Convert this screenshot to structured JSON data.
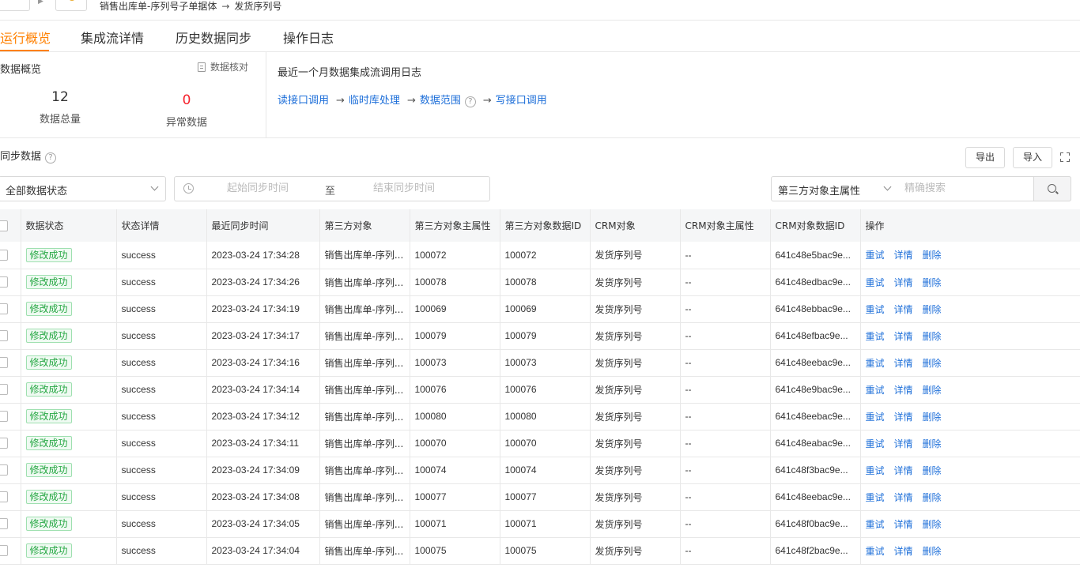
{
  "breadcrumb": {
    "source": "销售出库单-序列号子单据体",
    "target": "发货序列号"
  },
  "tabs": [
    "运行概览",
    "集成流详情",
    "历史数据同步",
    "操作日志"
  ],
  "overview": {
    "title": "数据概览",
    "check_label": "数据核对",
    "total_value": "12",
    "total_label": "数据总量",
    "error_value": "0",
    "error_label": "异常数据",
    "log_title": "最近一个月数据集成流调用日志",
    "flow": [
      "读接口调用",
      "临时库处理",
      "数据范围",
      "写接口调用"
    ],
    "status_colors": {
      "error": "#f5222d",
      "accent": "#ff8000",
      "link": "#1e6fd9",
      "success": "#27a844"
    }
  },
  "sync": {
    "title": "同步数据",
    "export_label": "导出",
    "import_label": "导入",
    "status_select": "全部数据状态",
    "start_placeholder": "起始同步时间",
    "to_label": "至",
    "end_placeholder": "结束同步时间",
    "field_select": "第三方对象主属性",
    "search_placeholder": "精确搜索"
  },
  "table": {
    "headers": [
      "数据状态",
      "状态详情",
      "最近同步时间",
      "第三方对象",
      "第三方对象主属性",
      "第三方对象数据ID",
      "CRM对象",
      "CRM对象主属性",
      "CRM对象数据ID",
      "操作"
    ],
    "actions": [
      "重试",
      "详情",
      "删除"
    ],
    "rows": [
      {
        "status": "修改成功",
        "detail": "success",
        "time": "2023-03-24 17:34:28",
        "third_obj": "销售出库单-序列...",
        "third_attr": "100072",
        "third_id": "100072",
        "crm_obj": "发货序列号",
        "crm_attr": "--",
        "crm_id": "641c48e5bac9e..."
      },
      {
        "status": "修改成功",
        "detail": "success",
        "time": "2023-03-24 17:34:26",
        "third_obj": "销售出库单-序列...",
        "third_attr": "100078",
        "third_id": "100078",
        "crm_obj": "发货序列号",
        "crm_attr": "--",
        "crm_id": "641c48edbac9e..."
      },
      {
        "status": "修改成功",
        "detail": "success",
        "time": "2023-03-24 17:34:19",
        "third_obj": "销售出库单-序列...",
        "third_attr": "100069",
        "third_id": "100069",
        "crm_obj": "发货序列号",
        "crm_attr": "--",
        "crm_id": "641c48ebbac9e..."
      },
      {
        "status": "修改成功",
        "detail": "success",
        "time": "2023-03-24 17:34:17",
        "third_obj": "销售出库单-序列...",
        "third_attr": "100079",
        "third_id": "100079",
        "crm_obj": "发货序列号",
        "crm_attr": "--",
        "crm_id": "641c48efbac9e..."
      },
      {
        "status": "修改成功",
        "detail": "success",
        "time": "2023-03-24 17:34:16",
        "third_obj": "销售出库单-序列...",
        "third_attr": "100073",
        "third_id": "100073",
        "crm_obj": "发货序列号",
        "crm_attr": "--",
        "crm_id": "641c48eebac9e..."
      },
      {
        "status": "修改成功",
        "detail": "success",
        "time": "2023-03-24 17:34:14",
        "third_obj": "销售出库单-序列...",
        "third_attr": "100076",
        "third_id": "100076",
        "crm_obj": "发货序列号",
        "crm_attr": "--",
        "crm_id": "641c48e9bac9e..."
      },
      {
        "status": "修改成功",
        "detail": "success",
        "time": "2023-03-24 17:34:12",
        "third_obj": "销售出库单-序列...",
        "third_attr": "100080",
        "third_id": "100080",
        "crm_obj": "发货序列号",
        "crm_attr": "--",
        "crm_id": "641c48eebac9e..."
      },
      {
        "status": "修改成功",
        "detail": "success",
        "time": "2023-03-24 17:34:11",
        "third_obj": "销售出库单-序列...",
        "third_attr": "100070",
        "third_id": "100070",
        "crm_obj": "发货序列号",
        "crm_attr": "--",
        "crm_id": "641c48eabac9e..."
      },
      {
        "status": "修改成功",
        "detail": "success",
        "time": "2023-03-24 17:34:09",
        "third_obj": "销售出库单-序列...",
        "third_attr": "100074",
        "third_id": "100074",
        "crm_obj": "发货序列号",
        "crm_attr": "--",
        "crm_id": "641c48f3bac9e..."
      },
      {
        "status": "修改成功",
        "detail": "success",
        "time": "2023-03-24 17:34:08",
        "third_obj": "销售出库单-序列...",
        "third_attr": "100077",
        "third_id": "100077",
        "crm_obj": "发货序列号",
        "crm_attr": "--",
        "crm_id": "641c48eebac9e..."
      },
      {
        "status": "修改成功",
        "detail": "success",
        "time": "2023-03-24 17:34:05",
        "third_obj": "销售出库单-序列...",
        "third_attr": "100071",
        "third_id": "100071",
        "crm_obj": "发货序列号",
        "crm_attr": "--",
        "crm_id": "641c48f0bac9e..."
      },
      {
        "status": "修改成功",
        "detail": "success",
        "time": "2023-03-24 17:34:04",
        "third_obj": "销售出库单-序列...",
        "third_attr": "100075",
        "third_id": "100075",
        "crm_obj": "发货序列号",
        "crm_attr": "--",
        "crm_id": "641c48f2bac9e..."
      }
    ]
  }
}
